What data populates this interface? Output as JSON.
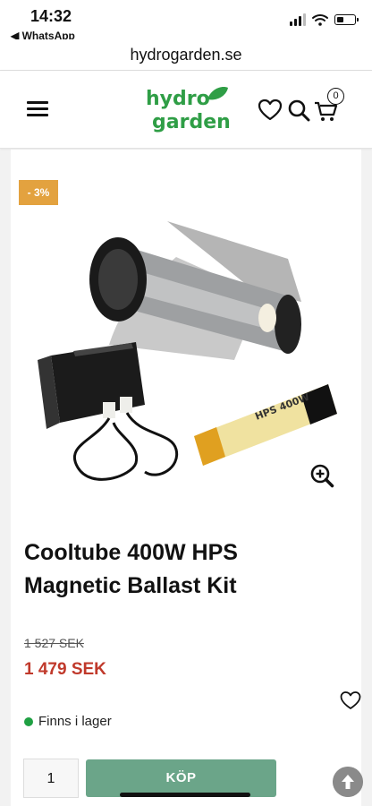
{
  "status": {
    "time": "14:32",
    "back_app": "◀ WhatsApp"
  },
  "browser": {
    "url": "hydrogarden.se"
  },
  "header": {
    "logo_top": "hydro",
    "logo_bottom": "garden",
    "cart_count": "0"
  },
  "product": {
    "discount_badge": "- 3%",
    "title": "Cooltube 400W HPS Magnetic Ballast Kit",
    "old_price": "1 527 SEK",
    "price": "1 479 SEK",
    "stock": "Finns i lager",
    "quantity": "1",
    "buy_label": "KÖP",
    "lamp_label": "HPS 400W"
  },
  "colors": {
    "brand_green": "#2f9e46",
    "discount_orange": "#e3a23f",
    "buy_green": "#6ba589",
    "price_red": "#c0392b",
    "stock_green": "#1fa043"
  },
  "icons": [
    "menu-icon",
    "heart-icon",
    "search-icon",
    "cart-icon",
    "zoom-in-icon",
    "wishlist-heart-icon",
    "arrow-up-icon"
  ]
}
